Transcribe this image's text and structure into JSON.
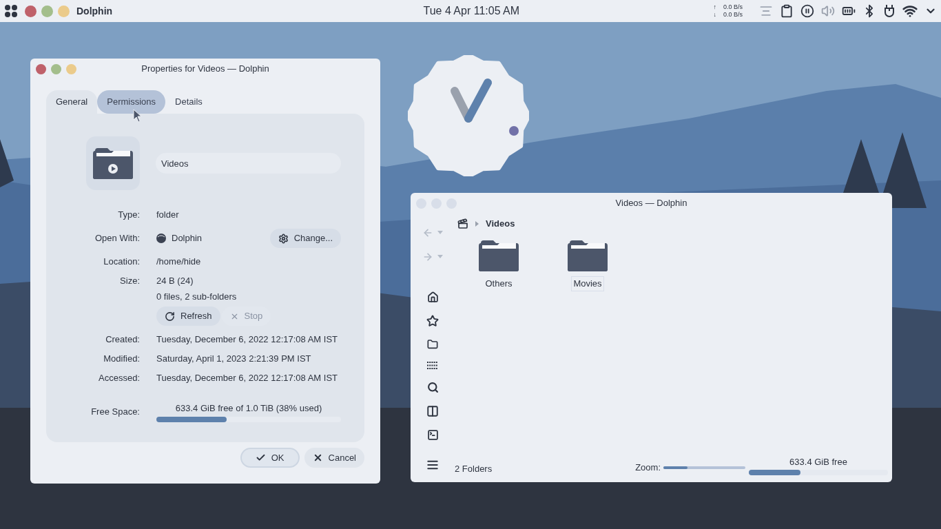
{
  "panel": {
    "app_name": "Dolphin",
    "clock": "Tue 4 Apr 11:05 AM",
    "net": [
      {
        "arrow": "↑",
        "rate": "0.0 B/s"
      },
      {
        "arrow": "↓",
        "rate": "0.0 B/s"
      }
    ]
  },
  "properties": {
    "title": "Properties for Videos — Dolphin",
    "tabs": [
      {
        "label": "General",
        "selected": true,
        "hovered": false
      },
      {
        "label": "Permissions",
        "selected": false,
        "hovered": true
      },
      {
        "label": "Details",
        "selected": false,
        "hovered": false
      }
    ],
    "name": "Videos",
    "rows": [
      {
        "kind": "text",
        "label": "Type:",
        "value": "folder"
      },
      {
        "kind": "app",
        "label": "Open With:",
        "value": "Dolphin",
        "button": "Change..."
      },
      {
        "kind": "text",
        "label": "Location:",
        "value": "/home/hide"
      },
      {
        "kind": "size",
        "label": "Size:",
        "value": "24 B (24)",
        "detail": "0 files, 2 sub-folders",
        "buttons": [
          {
            "label": "Refresh",
            "disabled": false
          },
          {
            "label": "Stop",
            "disabled": true
          }
        ]
      },
      {
        "kind": "date",
        "label": "Created:",
        "value": "Tuesday, December 6, 2022 12:17:08 AM IST"
      },
      {
        "kind": "date",
        "label": "Modified:",
        "value": "Saturday, April 1, 2023 2:21:39 PM IST"
      },
      {
        "kind": "date",
        "label": "Accessed:",
        "value": "Tuesday, December 6, 2022 12:17:08 AM IST"
      },
      {
        "kind": "space",
        "label": "Free Space:",
        "value": "633.4 GiB free of 1.0 TiB (38% used)",
        "level": 0.38
      }
    ],
    "buttons": [
      {
        "label": "OK",
        "default": true
      },
      {
        "label": "Cancel",
        "default": false
      }
    ]
  },
  "dolphin": {
    "title": "Videos — Dolphin",
    "back_disabled": true,
    "forward_disabled": true,
    "breadcrumb": "Videos",
    "files": [
      {
        "name": "Others",
        "focused": false
      },
      {
        "name": "Movies",
        "focused": true
      }
    ],
    "status": "2 Folders",
    "zoom_label": "Zoom:",
    "zoom": {
      "level": 0.29
    },
    "free": {
      "text": "633.4 GiB free",
      "level": 0.37
    }
  }
}
